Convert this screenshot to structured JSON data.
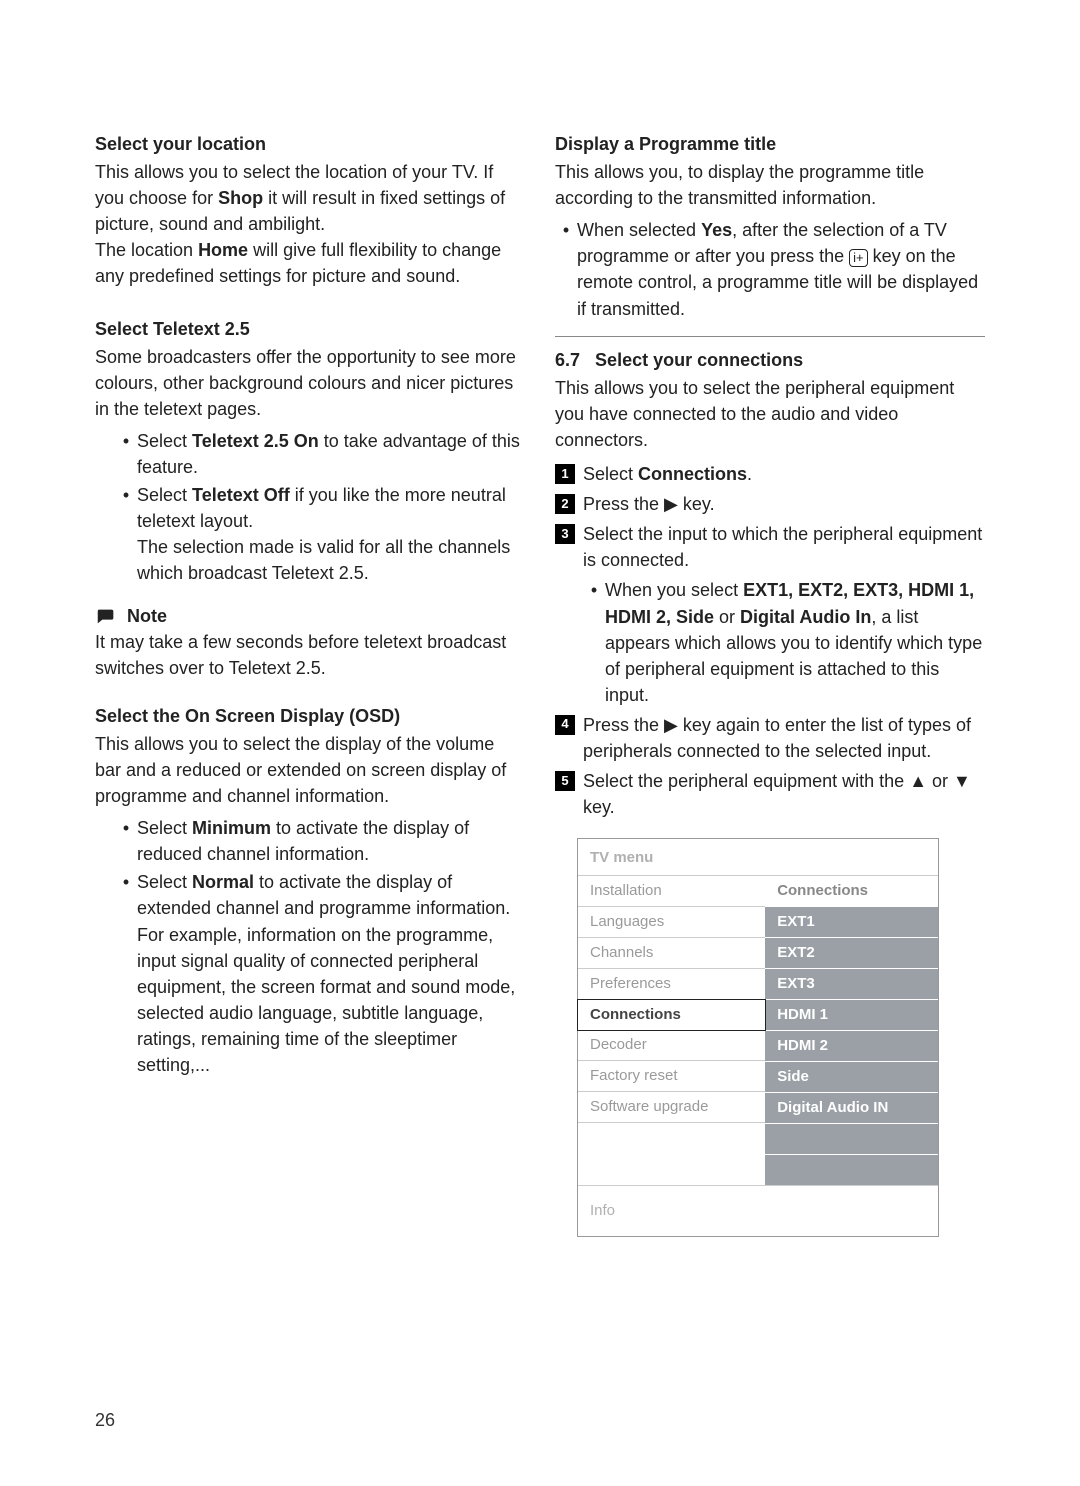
{
  "left": {
    "h1": "Select your location",
    "p1a": "This allows you to select the location of your TV. If you choose for ",
    "p1b": "Shop",
    "p1c": " it will result in fixed settings of picture, sound and ambilight.",
    "p1d": "The location ",
    "p1e": "Home",
    "p1f": " will give full flexibility to change any predefined settings for picture and sound.",
    "h2": "Select Teletext 2.5",
    "p2": "Some broadcasters offer the opportunity to see more colours, other background colours and nicer pictures in the teletext pages.",
    "b1a": "Select ",
    "b1b": "Teletext 2.5 On",
    "b1c": " to take advantage of this feature.",
    "b2a": "Select ",
    "b2b": "Teletext Off",
    "b2c": " if you like the more neutral teletext layout.",
    "b2d": "The selection made is valid for all the channels which broadcast Teletext 2.5.",
    "note_label": "Note",
    "note_text": "It may take a few seconds before teletext broadcast switches over to Teletext 2.5.",
    "h3": "Select the On Screen Display (OSD)",
    "p3": "This allows you to select the display of the volume bar and a reduced or extended on screen display of programme and channel information.",
    "b3a": "Select ",
    "b3b": "Minimum",
    "b3c": " to activate the display of reduced channel information.",
    "b4a": "Select ",
    "b4b": "Normal",
    "b4c": " to activate the display of extended channel and programme information. For example, information on the programme, input signal quality of connected peripheral equipment, the screen format and sound mode, selected audio language, subtitle language, ratings, remaining time of the sleeptimer setting,..."
  },
  "right": {
    "h1": "Display a Programme title",
    "p1": "This allows you, to display the programme title according to the transmitted information.",
    "b1a": "When selected ",
    "b1b": "Yes",
    "b1c": ", after the selection of a TV programme or after you press the ",
    "b1d": " key on the remote control, a  programme title will be displayed if transmitted.",
    "section_num": "6.7",
    "section_title": "Select your connections",
    "p2": "This allows you to select the peripheral equipment you have connected to the audio and video connectors.",
    "s1a": "Select ",
    "s1b": "Connections",
    "s1c": ".",
    "s2a": "Press the ",
    "s2b": " key.",
    "s3": "Select the input to which the peripheral equipment is connected.",
    "s3sub_a": "When you select ",
    "s3sub_b": "EXT1, EXT2, EXT3, HDMI 1, HDMI 2, Side",
    "s3sub_c": " or ",
    "s3sub_d": "Digital Audio In",
    "s3sub_e": ", a list appears which allows you to identify which type of peripheral equipment is attached to this input.",
    "s4a": "Press the ",
    "s4b": " key again to enter the list of types of peripherals connected to the selected input.",
    "s5a": "Select the peripheral equipment with the ",
    "s5b": " or ",
    "s5c": " key.",
    "info_glyph": "i+",
    "steps": [
      "1",
      "2",
      "3",
      "4",
      "5"
    ]
  },
  "menu": {
    "title": "TV menu",
    "left_header": "Installation",
    "left_items": [
      "Languages",
      "Channels",
      "Preferences",
      "Connections",
      "Decoder",
      "Factory reset",
      "Software upgrade"
    ],
    "right_header": "Connections",
    "right_items": [
      "EXT1",
      "EXT2",
      "EXT3",
      "HDMI 1",
      "HDMI 2",
      "Side",
      "Digital Audio IN"
    ],
    "selected_left": "Connections",
    "info": "Info"
  },
  "page_number": "26"
}
